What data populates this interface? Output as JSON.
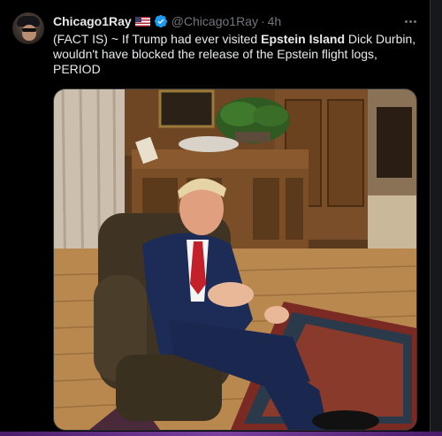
{
  "user": {
    "display_name": "Chicago1Ray",
    "flag_emoji": "us-flag-icon",
    "verified": true,
    "handle": "@Chicago1Ray",
    "separator": "·",
    "time": "4h"
  },
  "tweet": {
    "text_parts": [
      {
        "text": "(FACT IS) ~ If Trump had ever visited ",
        "bold": false
      },
      {
        "text": "Epstein Island",
        "bold": true
      },
      {
        "text": " Dick Durbin, wouldn't have blocked the release of the Epstein flight logs, PERIOD",
        "bold": false
      }
    ]
  },
  "media": {
    "kind": "photo",
    "icon": "photo-image"
  },
  "colors": {
    "background": "#000000",
    "text": "#e7e9ea",
    "secondary_text": "#71767b",
    "verified_blue": "#1d9bf0",
    "border": "#2f3336"
  }
}
